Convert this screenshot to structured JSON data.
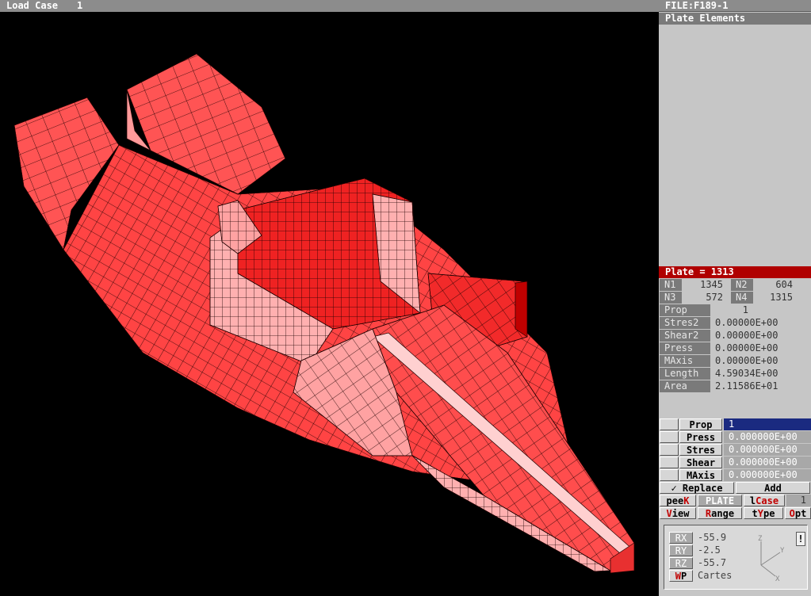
{
  "topbar": {
    "label": "Load Case",
    "value": "1"
  },
  "panel": {
    "file": "FILE:F189-1",
    "element_type": "Plate Elements",
    "plate": "Plate =   1313",
    "nodes": [
      {
        "label": "N1",
        "value": "1345"
      },
      {
        "label": "N2",
        "value": "604"
      },
      {
        "label": "N3",
        "value": "572"
      },
      {
        "label": "N4",
        "value": "1315"
      }
    ],
    "props": [
      {
        "label": "Prop",
        "value": "1"
      },
      {
        "label": "Stres2",
        "value": "0.00000E+00"
      },
      {
        "label": "Shear2",
        "value": "0.00000E+00"
      },
      {
        "label": "Press",
        "value": "0.00000E+00"
      },
      {
        "label": "MAxis",
        "value": "0.00000E+00"
      },
      {
        "label": "Length",
        "value": "4.59034E+00"
      },
      {
        "label": "Area",
        "value": "2.11586E+01"
      }
    ],
    "edit": [
      {
        "label": "Prop",
        "value": "1"
      },
      {
        "label": "Press",
        "value": "0.000000E+00"
      },
      {
        "label": "Stres",
        "value": "0.000000E+00"
      },
      {
        "label": "Shear",
        "value": "0.000000E+00"
      },
      {
        "label": "MAxis",
        "value": "0.000000E+00"
      }
    ],
    "replace": "✓ Replace",
    "add": "Add",
    "peek_a": "pee",
    "peek_b": "K",
    "plate_btn": "PLATE",
    "lcase_a": "l",
    "lcase_b": "Case",
    "lcase_val": "1",
    "view_a": "V",
    "view_b": "iew",
    "range_a": "R",
    "range_b": "ange",
    "type_a": "t",
    "type_b": "Y",
    "type_c": "pe",
    "opt_a": "O",
    "opt_b": "pt",
    "rot": [
      {
        "label": "RX",
        "value": "-55.9"
      },
      {
        "label": "RY",
        "value": "-2.5"
      },
      {
        "label": "RZ",
        "value": "-55.7"
      }
    ],
    "wp_a": "W",
    "wp_b": "P",
    "coord": "Cartes",
    "axes": {
      "z": "Z",
      "y": "Y",
      "x": "X"
    },
    "pin": "!"
  },
  "colors": {
    "mesh_fill": "#ff4d4d",
    "mesh_light": "#ff9a9a",
    "mesh_dark": "#e01e1e",
    "highlight": "#b00000"
  }
}
